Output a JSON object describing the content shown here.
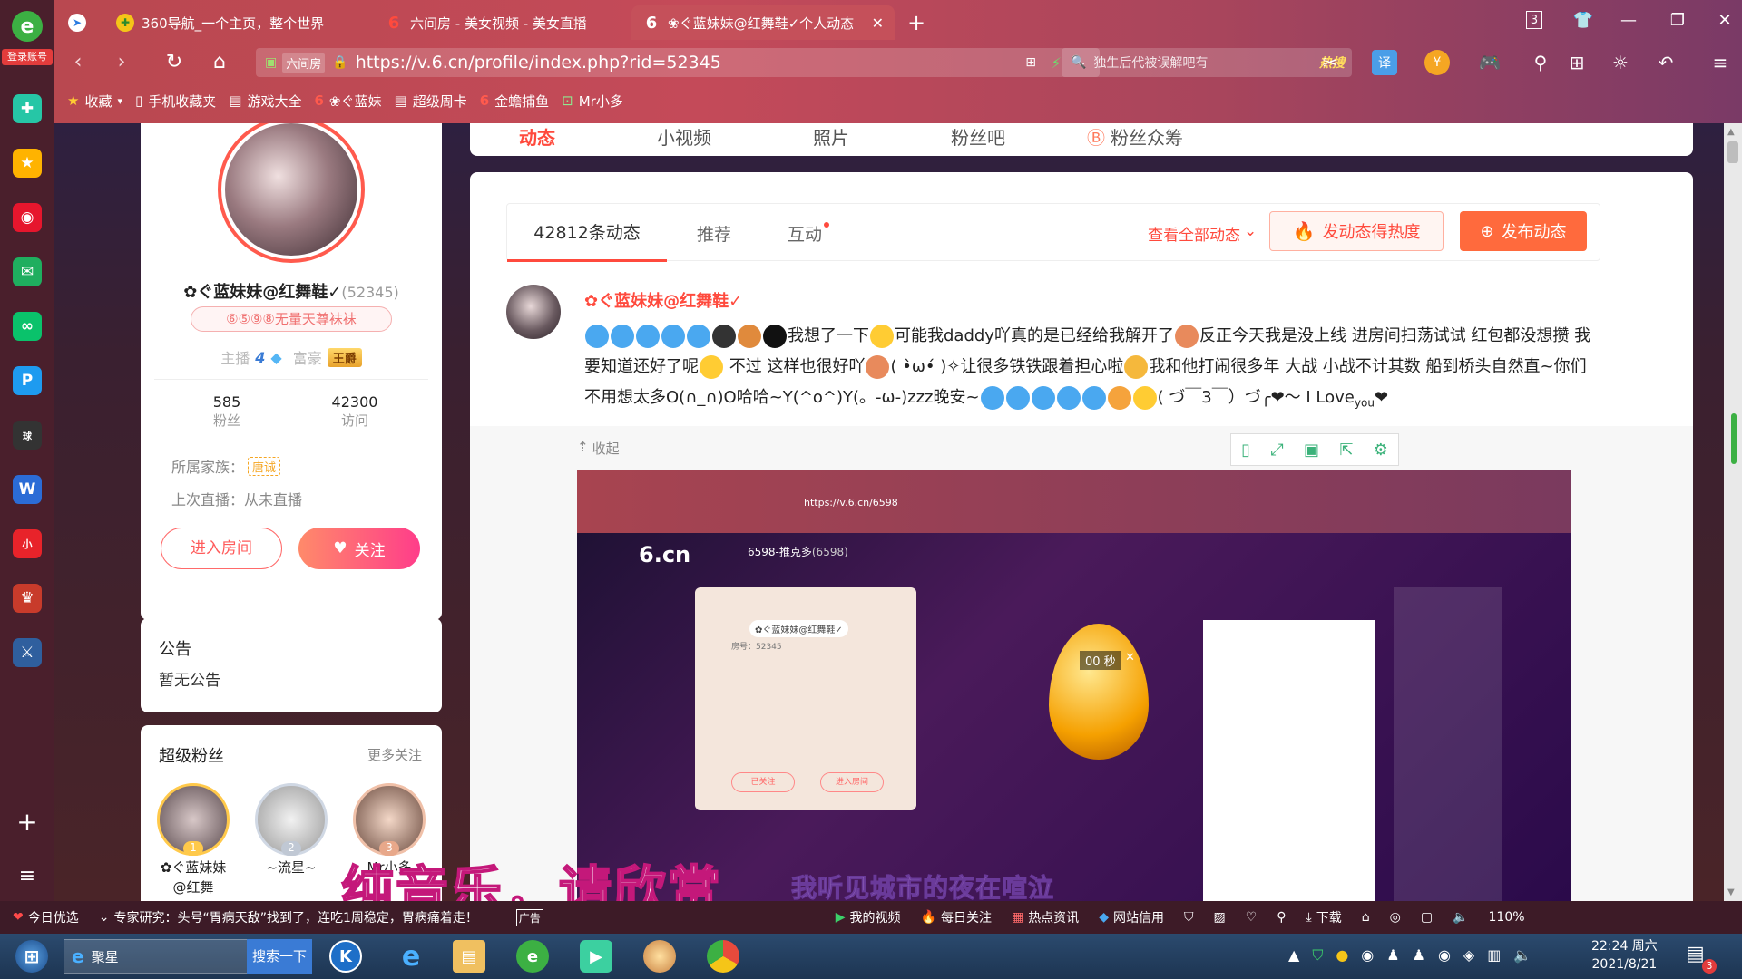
{
  "browser": {
    "sidebar_login": "登录账号",
    "tabs": [
      {
        "label": "360导航_一个主页，整个世界",
        "icon": "360-nav-icon"
      },
      {
        "label": "六间房 - 美女视频 - 美女直播",
        "icon": "6cn-icon"
      },
      {
        "label": "❀ぐ蓝妹妹@红舞鞋✓个人动态",
        "icon": "6cn-icon"
      }
    ],
    "url": "https://v.6.cn/profile/index.php?rid=52345",
    "url_site_label": "六间房",
    "search_placeholder": "独生后代被误解吧有",
    "search_hot": "热搜",
    "bookmarks": [
      "收藏",
      "手机收藏夹",
      "游戏大全",
      "❀ぐ蓝妹",
      "超级周卡",
      "金蟾捕鱼",
      "Mr小多"
    ]
  },
  "profile": {
    "name": "✿ぐ蓝妹妹@红舞鞋✓",
    "rid": "(52345)",
    "badge_text": "⑥⑤⑨⑧无量天尊袜袜",
    "host_label": "主播",
    "host_level": "4",
    "rich_label": "富豪",
    "rich_level": "王爵",
    "stats": [
      {
        "value": "585",
        "label": "粉丝"
      },
      {
        "value": "42300",
        "label": "访问"
      }
    ],
    "family_label": "所属家族：",
    "family_value": "唐诚",
    "last_live": "上次直播：从未直播",
    "enter_room": "进入房间",
    "follow": "关注"
  },
  "announcement": {
    "title": "公告",
    "content": "暂无公告"
  },
  "superfans": {
    "title": "超级粉丝",
    "more": "更多关注",
    "fans": [
      {
        "rank": "1",
        "name": "✿ぐ蓝妹妹@红舞"
      },
      {
        "rank": "2",
        "name": "~流星~"
      },
      {
        "rank": "3",
        "name": "Mr小多"
      }
    ]
  },
  "top_nav": {
    "items": [
      "动态",
      "小视频",
      "照片",
      "粉丝吧",
      "粉丝众筹"
    ]
  },
  "feed": {
    "tabs": [
      "42812条动态",
      "推荐",
      "互动"
    ],
    "view_all": "查看全部动态",
    "heat_button": "发动态得热度",
    "publish_button": "发布动态",
    "post": {
      "author": "✿ぐ蓝妹妹@红舞鞋✓",
      "text_1": "我想了一下",
      "text_2": "可能我daddy吖真的是已经给我解开了",
      "text_3": "反正今天我是没上线 进房间扫荡试试 红包都没想攒 我要知道还好了呢",
      "text_4": "不过 这样也很好吖",
      "text_5": "( •̀ω•́ )✧让很多铁铁跟着担心啦",
      "text_6": "我和他打闹很多年 大战 小战不计其数 船到桥头自然直~你们不用想太多O(∩_∩)O哈哈~Y(^o^)Y(。-ω-)zzz晚安~",
      "text_7": "( づ￣3￣）づ╭❤～ I Love",
      "text_8": "you",
      "collapse": "收起"
    }
  },
  "embedded": {
    "url": "https://v.6.cn/6598",
    "room_title": "6598-推克多",
    "room_id": "(6598)",
    "timer": "00 秒",
    "popup_name": "✿ぐ蓝妹妹@红舞鞋✓",
    "popup_id": "房号：52345",
    "popup_follow": "已关注",
    "popup_enter": "进入房间"
  },
  "subtitle": {
    "line1": "纯音乐，请欣赏",
    "line2": "我听见城市的夜在喧泣"
  },
  "statusbar": {
    "news_label": "今日优选",
    "news_text": "专家研究：头号“胃病天敌”找到了，连吃1周稳定，胃病痛着走！",
    "news_tag": "广告",
    "items": [
      "我的视频",
      "每日关注",
      "热点资讯",
      "网站信用",
      "下载"
    ],
    "zoom": "110%"
  },
  "taskbar": {
    "app_label": "聚星",
    "search_btn": "搜索一下",
    "time": "22:24 周六",
    "date": "2021/8/21",
    "notif": "3"
  },
  "colors": {
    "accent": "#ff4a3d",
    "follow_gradient_start": "#ff8a6a",
    "follow_gradient_end": "#ff3d8a",
    "chrome": "#c44a59"
  }
}
